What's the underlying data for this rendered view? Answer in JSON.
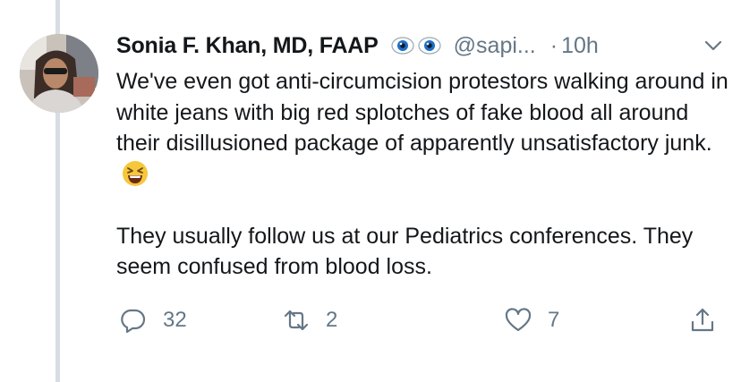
{
  "tweet": {
    "author_name": "Sonia F. Khan, MD, FAAP",
    "handle": "@sapi...",
    "separator": "·",
    "time": "10h",
    "paragraphs": [
      "We've even got anti-circumcision protestors walking around in white jeans with big red splotches of fake blood all around their disillusioned package of apparently unsatisfactory junk.",
      "They usually follow us at our Pediatrics conferences. They seem confused from blood loss."
    ],
    "emoji": "laughing-squinting-face"
  },
  "actions": {
    "reply_count": "32",
    "retweet_count": "2",
    "like_count": "7"
  },
  "colors": {
    "secondary_text": "#657786",
    "thread_line": "#d7dde3",
    "eye_blue": "#1f6fc5"
  },
  "icons": [
    "eye-icon",
    "eye-icon",
    "chevron-down-icon",
    "reply-icon",
    "retweet-icon",
    "heart-icon",
    "share-icon"
  ]
}
